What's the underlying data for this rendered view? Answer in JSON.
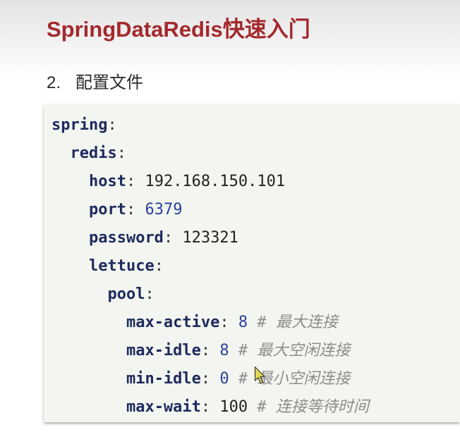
{
  "slide": {
    "title": "SpringDataRedis快速入门",
    "section": {
      "number": "2.",
      "title": "配置文件"
    }
  },
  "code": {
    "separator": ":",
    "lines": [
      {
        "key": "spring"
      },
      {
        "key": "redis"
      },
      {
        "key": "host",
        "value": "192.168.150.101"
      },
      {
        "key": "port",
        "value": "6379"
      },
      {
        "key": "password",
        "value": "123321"
      },
      {
        "key": "lettuce"
      },
      {
        "key": "pool"
      },
      {
        "key": "max-active",
        "value": "8",
        "comment": "# 最大连接"
      },
      {
        "key": "max-idle",
        "value": "8",
        "comment": "# 最大空闲连接"
      },
      {
        "key": "min-idle",
        "value": "0",
        "comment": "# 最小空闲连接"
      },
      {
        "key": "max-wait",
        "value": "100",
        "comment": "# 连接等待时间"
      }
    ]
  },
  "colors": {
    "title": "#a3292c",
    "key": "#1e2a5e",
    "number": "#2b3f9c",
    "text": "#222222",
    "comment": "#8c8c8c",
    "code_background": "#f3f6f0",
    "cursor_fill": "#e2db55"
  },
  "icons": {
    "cursor": "mouse-pointer-icon"
  }
}
